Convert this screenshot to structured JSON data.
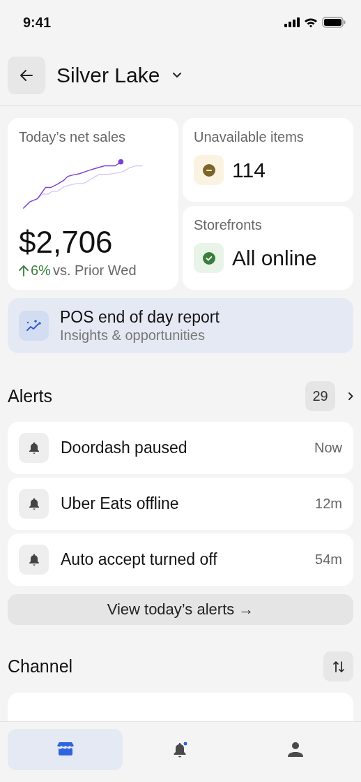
{
  "status_bar": {
    "time": "9:41"
  },
  "header": {
    "title": "Silver Lake"
  },
  "net_sales": {
    "label": "Today’s net sales",
    "value": "$2,706",
    "change": {
      "kind": "up",
      "amount": "6%",
      "comparison": "vs. Prior Wed"
    }
  },
  "unavailable": {
    "label": "Unavailable items",
    "kind": "warning",
    "value": "114"
  },
  "storefronts": {
    "label": "Storefronts",
    "kind": "ok",
    "value": "All online"
  },
  "report": {
    "title": "POS end of day report",
    "subtitle": "Insights & opportunities"
  },
  "alerts": {
    "title": "Alerts",
    "count": "29",
    "items": [
      {
        "text": "Doordash paused",
        "time": "Now"
      },
      {
        "text": "Uber Eats offline",
        "time": "12m"
      },
      {
        "text": "Auto accept turned off",
        "time": "54m"
      }
    ],
    "view_all": "View today’s alerts →"
  },
  "channel": {
    "title": "Channel"
  },
  "tabs": [
    {
      "kind": "store",
      "selected": true,
      "notification": false
    },
    {
      "kind": "alerts",
      "selected": false,
      "notification": true
    },
    {
      "kind": "profile",
      "selected": false,
      "notification": false
    }
  ]
}
